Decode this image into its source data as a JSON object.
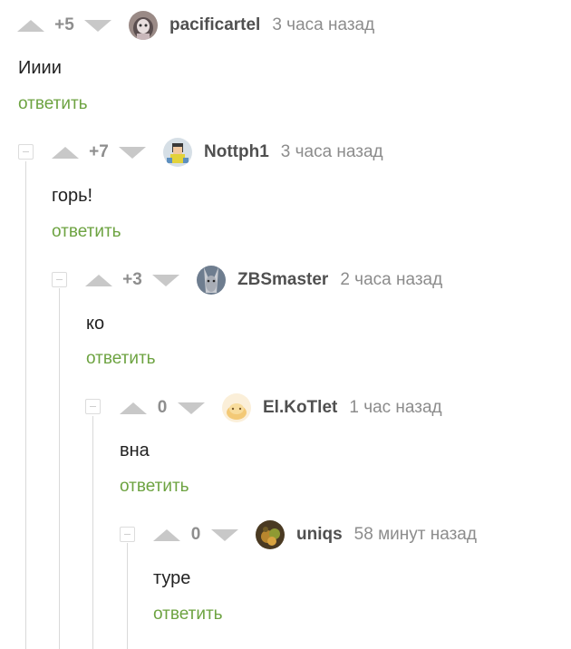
{
  "reply_label": "ответить",
  "colors": {
    "accent_green": "#6da341",
    "vote_gray": "#c8c8c8",
    "thread_line": "#d9d9d9"
  },
  "comments": [
    {
      "rating": "+5",
      "username": "pacificartel",
      "time": "3 часа назад",
      "text": "Ииии",
      "avatar_icon": "hooded-figure-avatar"
    },
    {
      "rating": "+7",
      "username": "Nottph1",
      "time": "3 часа назад",
      "text": "горь!",
      "avatar_icon": "pixel-character-avatar"
    },
    {
      "rating": "+3",
      "username": "ZBSmaster",
      "time": "2 часа назад",
      "text": "ко",
      "avatar_icon": "gray-creature-avatar"
    },
    {
      "rating": "0",
      "username": "El.KoTlet",
      "time": "1 час назад",
      "text": "вна",
      "avatar_icon": "cartoon-bun-avatar"
    },
    {
      "rating": "0",
      "username": "uniqs",
      "time": "58 минут назад",
      "text": "туре",
      "avatar_icon": "dark-fruit-avatar"
    }
  ]
}
